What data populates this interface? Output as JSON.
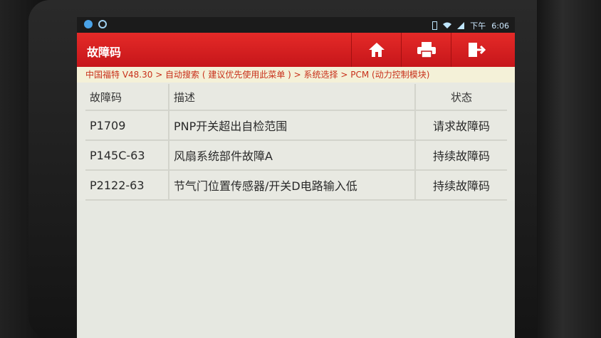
{
  "statusbar": {
    "time": "6:06",
    "ampm": "下午"
  },
  "app": {
    "title": "故障码",
    "buttons": {
      "home": "home-icon",
      "print": "print-icon",
      "exit": "exit-icon"
    }
  },
  "breadcrumb": "中国福特 V48.30 > 自动搜索 ( 建议优先使用此菜单 ) > 系统选择 > PCM (动力控制模块)",
  "table": {
    "headers": {
      "code": "故障码",
      "desc": "描述",
      "status": "状态"
    },
    "rows": [
      {
        "code": "P1709",
        "desc": "PNP开关超出自检范围",
        "status": "请求故障码"
      },
      {
        "code": "P145C-63",
        "desc": "风扇系统部件故障A",
        "status": "持续故障码"
      },
      {
        "code": "P2122-63",
        "desc": "节气门位置传感器/开关D电路输入低",
        "status": "持续故障码"
      }
    ]
  },
  "colors": {
    "titlebar": "#d81f22",
    "breadcrumb_text": "#c8301a",
    "screen_bg": "#e8e9e2"
  }
}
